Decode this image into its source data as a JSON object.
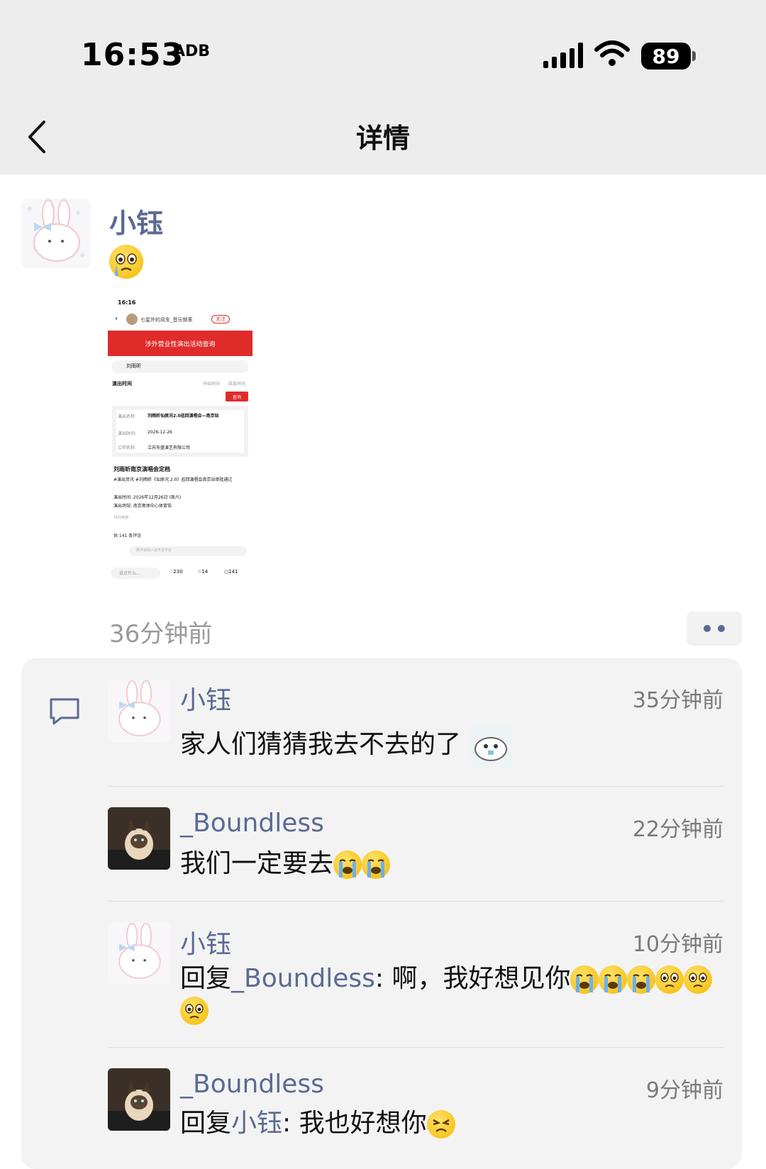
{
  "status_bar": {
    "time": "16:53",
    "extra": "ADB",
    "battery": "89"
  },
  "nav": {
    "title": "详情"
  },
  "post": {
    "author": "小钰",
    "time": "36分钟前",
    "screenshot": {
      "status_time": "16:16",
      "header_user": "七星外的风车_音乐频率",
      "follow": "关注",
      "banner": "涉外营业性演出活动查询",
      "search_value": "刘雨昕",
      "perf_time_label": "演出时间",
      "date_start": "开始时间",
      "date_end": "结束时间",
      "query_button": "查询",
      "field1_label": "演出名称:",
      "field1_value": "刘雨昕仙原况2.0巡回演唱会—南京站",
      "field2_label": "演出时间:",
      "field2_value": "2026-12-26",
      "field3_label": "公司名称:",
      "field3_value": "江苏东盛演艺有限公司",
      "post_title": "刘雨昕南京演唱会定档",
      "line1": "#演出资讯 #刘雨昕《仙原况 2.0》巡回演唱会南京站审批通过",
      "line2": "演出时间: 2026年12月26日 (周六)",
      "line3": "演出场馆: 南京奥体中心体育馆",
      "post_age": "16分钟前",
      "comments_count": "共 141 条评论",
      "input_placeholder": "要评论的人说不定不言",
      "bottom_input": "说点什么...",
      "likes": "230",
      "stars": "14",
      "comments": "141"
    }
  },
  "comments": [
    {
      "name": "小钰",
      "time": "35分钟前",
      "text": "家人们猜猜我去不去的了"
    },
    {
      "name": "_Boundless",
      "time": "22分钟前",
      "text": "我们一定要去"
    },
    {
      "name": "小钰",
      "time": "10分钟前",
      "reply_prefix": "回复",
      "reply_to": "_Boundless",
      "text": ": 啊，我好想见你"
    },
    {
      "name": "_Boundless",
      "time": "9分钟前",
      "reply_prefix": "回复",
      "reply_to": "小钰",
      "text": ": 我也好想你"
    }
  ],
  "icons": [
    "back-chevron-icon",
    "signal-icon",
    "wifi-icon",
    "battery-icon",
    "comment-bubble-icon",
    "more-dots-icon",
    "crying-emoji-icon",
    "teary-emoji-icon",
    "angry-emoji-icon"
  ],
  "colors": {
    "link": "#5b6a94",
    "banner_red": "#e02b2b",
    "panel_bg": "#f3f3f3"
  }
}
